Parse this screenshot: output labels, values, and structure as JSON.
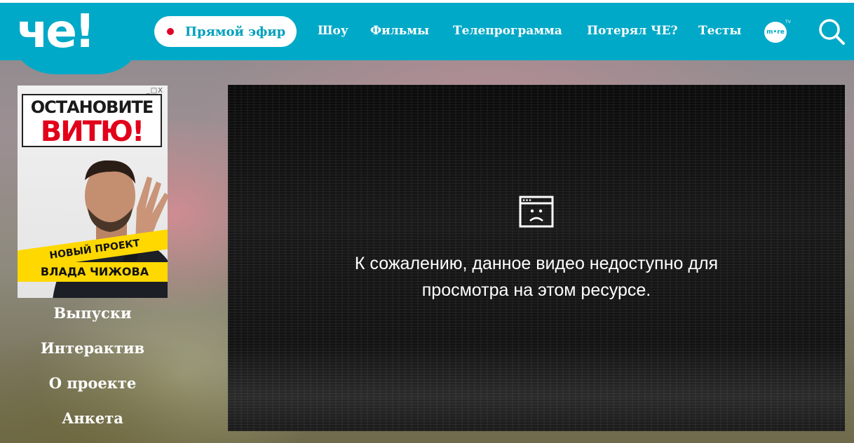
{
  "header": {
    "logo_text": "че!",
    "live_button": "Прямой эфир",
    "nav": [
      {
        "label": "Шоу"
      },
      {
        "label": "Фильмы"
      },
      {
        "label": "Телепрограмма"
      },
      {
        "label": "Потерял ЧЕ?"
      },
      {
        "label": "Тесты"
      }
    ],
    "partner_logo": "m•re",
    "partner_tv": "TV",
    "search_icon": "search-icon"
  },
  "banner": {
    "controls": "_□X",
    "title_line1": "ОСТАНОВИТЕ",
    "title_line2": "ВИТЮ!",
    "tape_line1": "НОВЫЙ ПРОЕКТ",
    "tape_line2": "ВЛАДА ЧИЖОВА"
  },
  "side_menu": [
    {
      "label": "Выпуски"
    },
    {
      "label": "Интерактив"
    },
    {
      "label": "О проекте"
    },
    {
      "label": "Анкета"
    }
  ],
  "video": {
    "icon": "sad-window-icon",
    "message_line1": "К сожалению, данное видео недоступно для",
    "message_line2": "просмотра на этом ресурсе."
  },
  "colors": {
    "header_bg": "#00a9c7",
    "live_dot": "#e0002a",
    "banner_red": "#e2001a",
    "tape_yellow": "#ffd800"
  }
}
